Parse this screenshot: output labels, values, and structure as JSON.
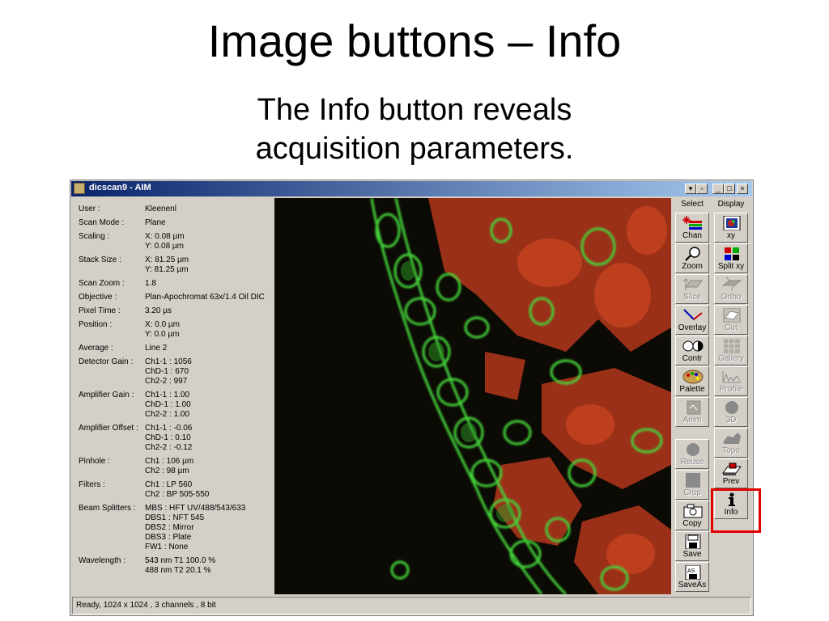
{
  "slide": {
    "title": "Image buttons – Info",
    "subtitle": "The Info button reveals acquisition parameters."
  },
  "window": {
    "title": "dicscan9 - AIM",
    "controls": {
      "extra": "▾",
      "restore": "▫",
      "minimize": "_",
      "maximize": "□",
      "close": "×"
    }
  },
  "info": [
    {
      "label": "User :",
      "values": [
        "Kleenenl"
      ]
    },
    {
      "label": "Scan Mode :",
      "values": [
        "Plane"
      ]
    },
    {
      "label": "Scaling :",
      "values": [
        "X: 0.08 µm",
        "Y: 0.08 µm"
      ]
    },
    {
      "label": "Stack Size :",
      "values": [
        "X: 81.25 µm",
        "Y: 81.25 µm"
      ]
    },
    {
      "label": "Scan Zoom :",
      "values": [
        "1.8"
      ]
    },
    {
      "label": "Objective :",
      "values": [
        "Plan-Apochromat 63x/1.4 Oil DIC"
      ]
    },
    {
      "label": "Pixel Time :",
      "values": [
        "3.20 µs"
      ]
    },
    {
      "label": "Position :",
      "values": [
        "X: 0.0 µm",
        "Y: 0.0 µm"
      ]
    },
    {
      "label": "Average :",
      "values": [
        "Line 2"
      ]
    },
    {
      "label": "Detector Gain :",
      "values": [
        "Ch1-1 : 1056",
        "ChD-1 : 670",
        "Ch2-2 : 997"
      ]
    },
    {
      "label": "Amplifier Gain :",
      "values": [
        "Ch1-1 : 1.00",
        "ChD-1 : 1.00",
        "Ch2-2 : 1.00"
      ]
    },
    {
      "label": "Amplifier Offset :",
      "values": [
        "Ch1-1 : -0.06",
        "ChD-1 : 0.10",
        "Ch2-2 : -0.12"
      ]
    },
    {
      "label": "Pinhole :",
      "values": [
        "Ch1 : 106 µm",
        "Ch2 : 98 µm"
      ]
    },
    {
      "label": "Filters :",
      "values": [
        "Ch1 : LP 560",
        "Ch2 : BP 505-550"
      ]
    },
    {
      "label": "Beam Splitters :",
      "values": [
        "MBS : HFT UV/488/543/633",
        "DBS1 : NFT 545",
        "DBS2 : Mirror",
        "DBS3 : Plate",
        "FW1 : None"
      ]
    },
    {
      "label": "Wavelength :",
      "values": [
        "543 nm T1 100.0 %",
        "488 nm T2 20.1 %"
      ]
    }
  ],
  "toolbar": {
    "select_header": "Select",
    "display_header": "Display",
    "select": [
      {
        "label": "Chan",
        "icon": "channels-icon",
        "enabled": true
      },
      {
        "label": "Zoom",
        "icon": "magnifier-icon",
        "enabled": true
      },
      {
        "label": "Slice",
        "icon": "slice-icon",
        "enabled": false
      },
      {
        "label": "Overlay",
        "icon": "overlay-icon",
        "enabled": true
      },
      {
        "label": "Contr",
        "icon": "contrast-icon",
        "enabled": true
      },
      {
        "label": "Palette",
        "icon": "palette-icon",
        "enabled": true
      },
      {
        "label": "Anim",
        "icon": "animation-icon",
        "enabled": false
      },
      {
        "label": "Reuse",
        "icon": "reuse-icon",
        "enabled": false
      },
      {
        "label": "Crop",
        "icon": "crop-icon",
        "enabled": false
      },
      {
        "label": "Copy",
        "icon": "camera-icon",
        "enabled": true
      },
      {
        "label": "Save",
        "icon": "floppy-icon",
        "enabled": true
      },
      {
        "label": "SaveAs",
        "icon": "floppy-as-icon",
        "enabled": true
      }
    ],
    "display": [
      {
        "label": "xy",
        "icon": "xy-icon",
        "enabled": true
      },
      {
        "label": "Split xy",
        "icon": "split-xy-icon",
        "enabled": true
      },
      {
        "label": "Ortho",
        "icon": "ortho-icon",
        "enabled": false
      },
      {
        "label": "Cut",
        "icon": "cut-icon",
        "enabled": false
      },
      {
        "label": "Gallery",
        "icon": "gallery-icon",
        "enabled": false
      },
      {
        "label": "Profile",
        "icon": "profile-icon",
        "enabled": false
      },
      {
        "label": "3D",
        "icon": "sphere-icon",
        "enabled": false
      },
      {
        "label": "Topo",
        "icon": "topo-icon",
        "enabled": false
      },
      {
        "label": "Prev",
        "icon": "preview-icon",
        "enabled": true
      },
      {
        "label": "Info",
        "icon": "info-icon",
        "enabled": true
      }
    ]
  },
  "status": "Ready, 1024 x 1024 , 3 channels , 8 bit",
  "colors": {
    "titlebar": "#0a246a",
    "highlight": "#e00000",
    "image_green": "#3fd23a",
    "image_red": "#b8381a"
  }
}
